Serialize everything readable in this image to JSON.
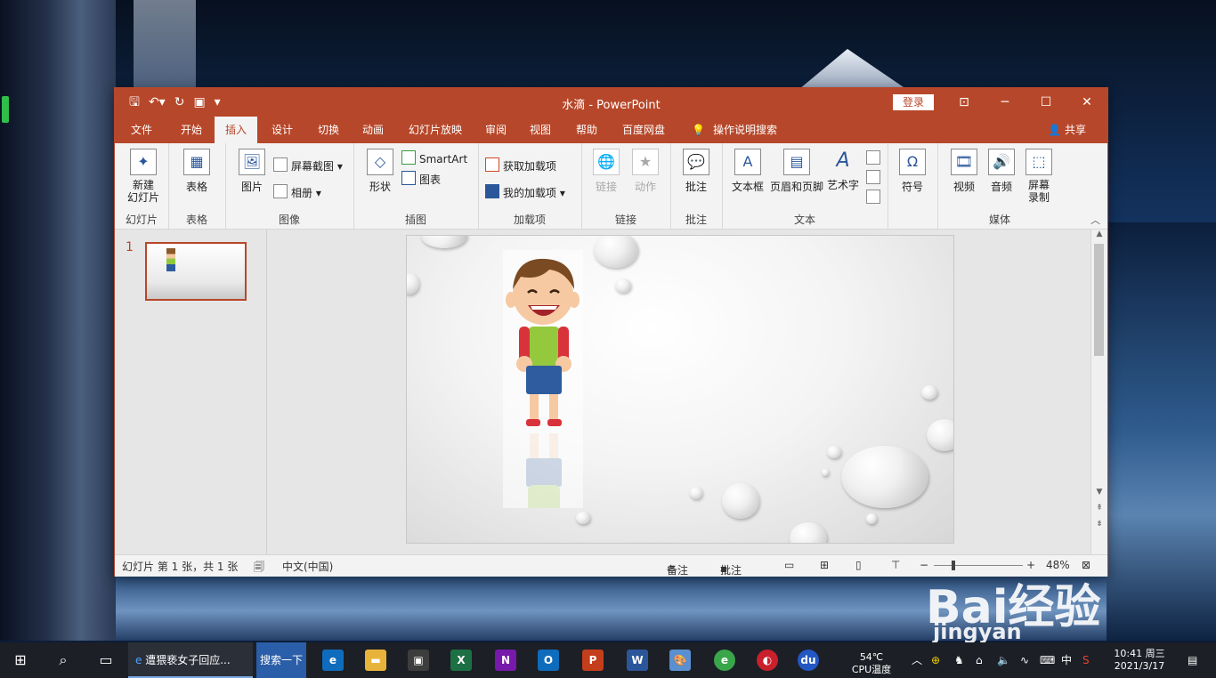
{
  "window": {
    "title": "水滴 - PowerPoint",
    "login": "登录",
    "qat_icons": [
      "save-icon",
      "undo-icon",
      "redo-icon",
      "present-icon",
      "customize-icon"
    ]
  },
  "tabs": [
    "文件",
    "开始",
    "插入",
    "设计",
    "切换",
    "动画",
    "幻灯片放映",
    "审阅",
    "视图",
    "帮助",
    "百度网盘",
    "操作说明搜索"
  ],
  "active_tab": "插入",
  "share": "共享",
  "ribbon": {
    "slides": {
      "new_slide": "新建\n幻灯片",
      "label": "幻灯片"
    },
    "tables": {
      "table": "表格",
      "label": "表格"
    },
    "images": {
      "pictures": "图片",
      "screenshot": "屏幕截图",
      "album": "相册",
      "label": "图像"
    },
    "illustrations": {
      "shapes": "形状",
      "smartart": "SmartArt",
      "chart": "图表",
      "label": "插图"
    },
    "addins": {
      "get": "获取加载项",
      "my": "我的加载项",
      "label": "加载项"
    },
    "links": {
      "link": "链接",
      "action": "动作",
      "label": "链接"
    },
    "comments": {
      "comment": "批注",
      "label": "批注"
    },
    "text": {
      "textbox": "文本框",
      "header_footer": "页眉和页脚",
      "wordart": "艺术字",
      "label": "文本"
    },
    "symbols": {
      "symbol": "符号"
    },
    "media": {
      "video": "视频",
      "audio": "音频",
      "screen_record": "屏幕\n录制",
      "label": "媒体"
    }
  },
  "thumbnails": {
    "number": "1"
  },
  "status": {
    "slide_info": "幻灯片 第 1 张，共 1 张",
    "language": "中文(中国)",
    "notes": "备注",
    "comments": "批注",
    "zoom": "48%"
  },
  "taskbar": {
    "browser_title": "遭猥亵女子回应...",
    "search_btn": "搜索一下",
    "temp": "54℃",
    "temp_label": "CPU温度",
    "ime": "中",
    "time": "10:41 周三",
    "date": "2021/3/17"
  },
  "watermark": {
    "logo": "Bai经验",
    "url": "jingyan"
  }
}
